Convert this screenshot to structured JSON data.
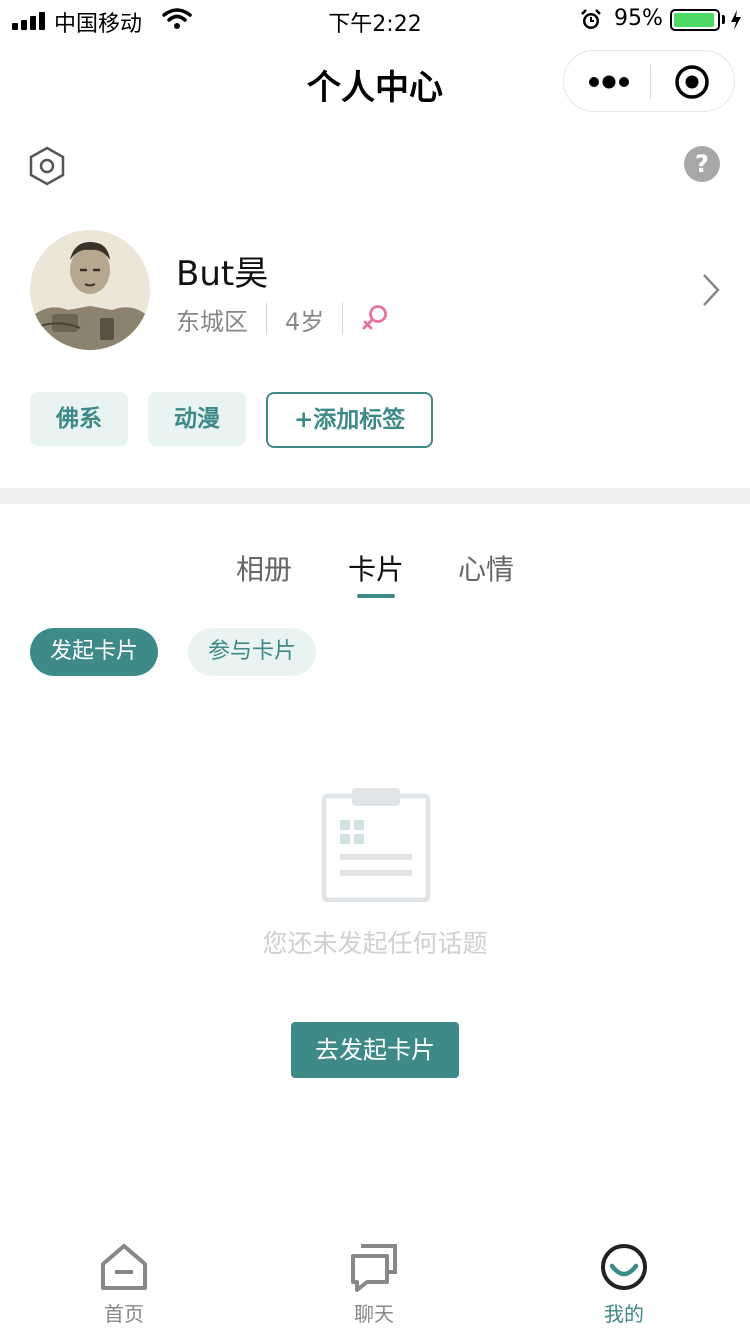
{
  "status_bar": {
    "carrier": "中国移动",
    "time": "下午2:22",
    "battery_percent": "95%",
    "battery_level": 0.95
  },
  "nav": {
    "title": "个人中心",
    "more_icon": "more-dots-icon",
    "close_icon": "close-circle-icon"
  },
  "header": {
    "settings_icon": "hexagon-settings-icon",
    "help_label": "?"
  },
  "profile": {
    "username": "But昊",
    "district": "东城区",
    "age": "4岁",
    "gender_icon": "female-icon"
  },
  "tags": {
    "items": [
      "佛系",
      "动漫"
    ],
    "add_label": "+添加标签"
  },
  "tabs": {
    "items": [
      "相册",
      "卡片",
      "心情"
    ],
    "active_index": 1
  },
  "subtabs": {
    "items": [
      "发起卡片",
      "参与卡片"
    ],
    "active_index": 0
  },
  "empty_state": {
    "message": "您还未发起任何话题",
    "button_label": "去发起卡片"
  },
  "tabbar": {
    "items": [
      {
        "label": "首页",
        "icon": "home-icon"
      },
      {
        "label": "聊天",
        "icon": "chat-icon"
      },
      {
        "label": "我的",
        "icon": "smile-profile-icon"
      }
    ],
    "active_index": 2
  },
  "colors": {
    "accent": "#3e8a88",
    "tag_background": "#e8f3f2",
    "gender_pink": "#e8739a",
    "battery_green": "#4cd964"
  }
}
